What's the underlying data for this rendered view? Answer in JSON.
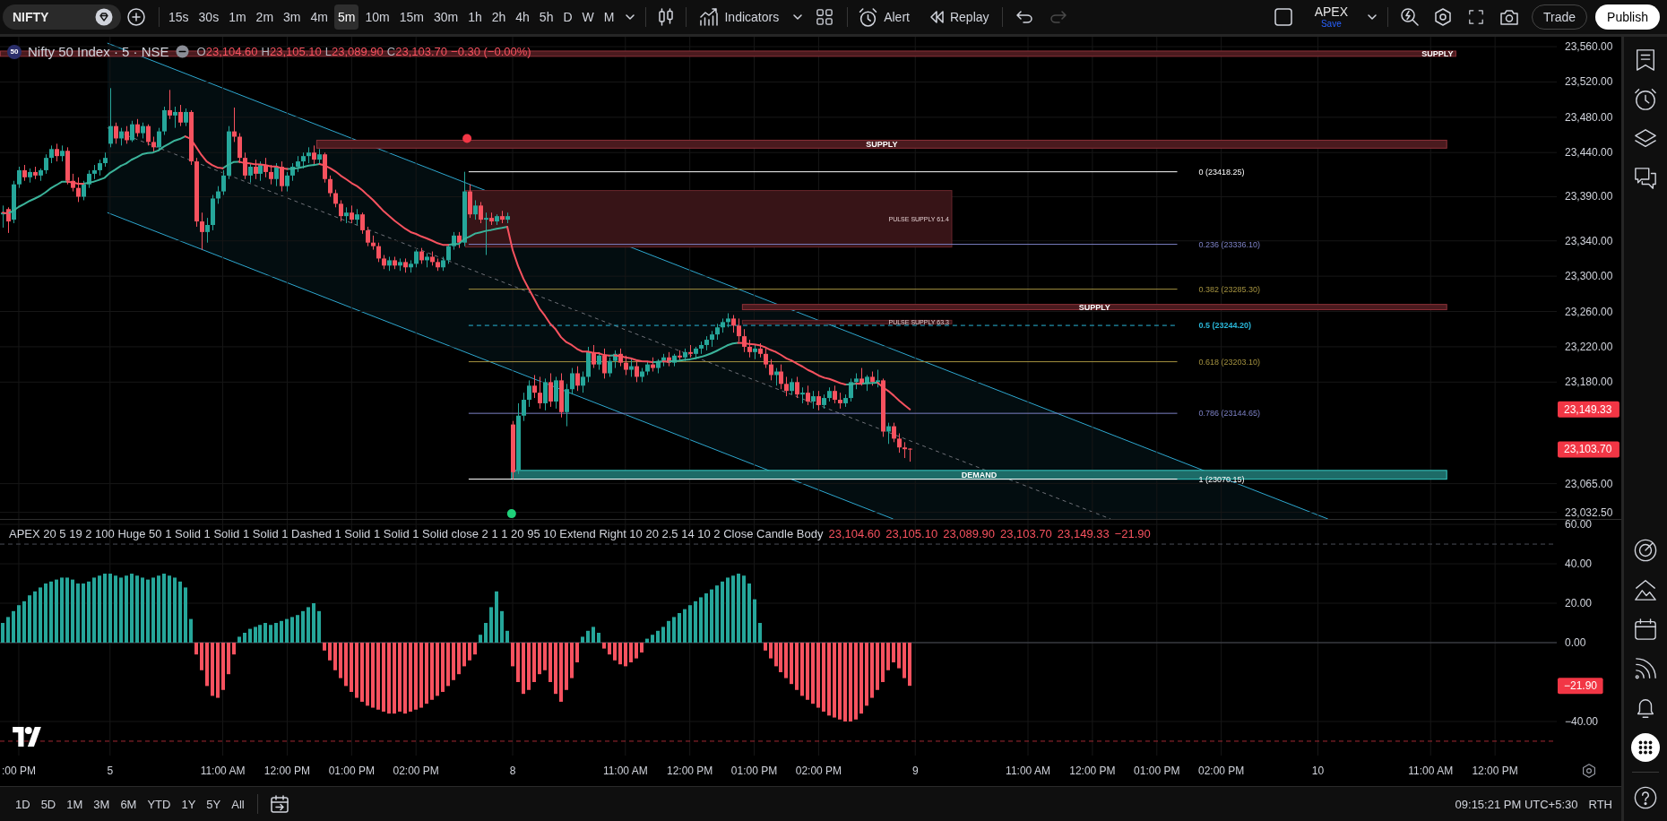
{
  "toolbar": {
    "symbol": "NIFTY",
    "timeframes": [
      {
        "label": "15s",
        "selected": false
      },
      {
        "label": "30s",
        "selected": false
      },
      {
        "label": "1m",
        "selected": false
      },
      {
        "label": "2m",
        "selected": false
      },
      {
        "label": "3m",
        "selected": false
      },
      {
        "label": "4m",
        "selected": false
      },
      {
        "label": "5m",
        "selected": true
      },
      {
        "label": "10m",
        "selected": false
      },
      {
        "label": "15m",
        "selected": false
      },
      {
        "label": "30m",
        "selected": false
      },
      {
        "label": "1h",
        "selected": false
      },
      {
        "label": "2h",
        "selected": false
      },
      {
        "label": "4h",
        "selected": false
      },
      {
        "label": "5h",
        "selected": false
      },
      {
        "label": "D",
        "selected": false
      },
      {
        "label": "W",
        "selected": false
      },
      {
        "label": "M",
        "selected": false
      }
    ],
    "indicators_label": "Indicators",
    "alert_label": "Alert",
    "replay_label": "Replay",
    "history": [
      {
        "kind": "undo",
        "disabled": false
      },
      {
        "kind": "redo",
        "disabled": true
      }
    ],
    "layout_name": "APEX",
    "save_label": "Save",
    "trade_label": "Trade",
    "publish_label": "Publish"
  },
  "price_chart": {
    "legend": {
      "logo_text": "50",
      "title": "Nifty 50 Index · 5 · NSE",
      "ohlc": [
        {
          "key": "O",
          "value": "23,104.60"
        },
        {
          "key": "H",
          "value": "23,105.10"
        },
        {
          "key": "L",
          "value": "23,089.90"
        },
        {
          "key": "C",
          "value": "23,103.70"
        }
      ],
      "change": "−0.30 (−0.00%)"
    },
    "chart_data": {
      "type": "candlestick",
      "grid": true,
      "ylim": [
        23025,
        23571.2
      ],
      "categories": [
        null,
        null,
        null,
        null,
        null,
        null,
        null,
        null,
        null,
        null,
        null,
        null,
        null,
        null,
        null,
        null,
        null,
        null,
        null,
        null,
        null,
        null,
        null,
        null,
        null,
        null,
        null,
        null,
        null,
        null,
        null,
        null,
        null,
        null,
        null,
        null,
        null,
        null,
        null,
        null,
        null,
        null,
        null,
        null,
        null,
        null,
        null,
        null,
        null,
        null,
        null,
        null,
        null,
        null,
        null,
        null,
        null,
        null,
        null,
        null,
        null,
        null,
        null,
        null,
        null,
        null,
        null,
        null,
        null,
        null,
        null,
        null,
        null,
        null,
        null,
        null,
        null,
        null,
        null,
        null,
        null,
        null,
        null,
        null,
        null,
        null,
        null,
        null,
        null,
        null,
        null,
        null,
        null,
        null,
        null,
        null,
        null,
        null,
        null,
        null,
        null,
        null,
        null,
        null,
        null,
        null,
        null,
        null,
        null,
        null,
        null,
        null,
        null,
        null,
        null,
        null,
        null,
        null,
        null,
        null,
        null,
        null,
        null,
        null,
        null,
        null,
        null,
        null,
        null,
        null,
        null,
        null,
        null,
        null,
        null,
        null,
        null,
        null,
        null,
        null,
        null,
        null,
        null,
        null,
        null,
        null,
        null,
        null,
        null,
        null,
        null,
        null,
        null,
        null,
        null,
        null,
        null,
        null,
        null,
        null,
        null,
        null,
        null,
        null,
        null,
        null,
        null,
        null,
        null,
        null,
        null,
        null,
        null,
        null,
        null,
        null,
        null,
        null,
        null,
        null,
        null,
        null,
        null,
        null,
        null,
        null,
        null,
        null,
        null,
        null,
        null,
        null,
        null,
        null,
        null,
        null,
        null,
        null,
        null,
        null,
        null,
        null,
        null,
        null,
        null,
        null,
        null,
        null,
        null,
        null,
        null,
        null,
        null,
        null,
        null,
        null,
        null,
        null,
        null,
        null,
        null,
        null,
        null,
        null,
        null,
        null,
        null,
        null,
        null,
        null,
        null,
        null,
        null,
        null,
        null,
        null,
        null,
        null,
        null,
        null,
        null,
        null,
        null,
        null,
        null,
        null,
        null,
        null,
        null,
        null,
        null,
        null,
        null,
        null,
        null,
        null,
        null,
        null,
        null,
        null,
        null,
        null,
        null,
        null,
        null,
        null,
        null,
        null,
        null,
        null,
        null,
        null,
        null,
        null,
        null,
        null,
        null,
        null,
        null,
        null,
        null,
        null,
        null,
        null,
        null,
        null,
        null,
        null,
        null,
        null
      ],
      "yticks": [
        {
          "value": 23560,
          "label": "23,560.00"
        },
        {
          "value": 23520,
          "label": "23,520.00"
        },
        {
          "value": 23480,
          "label": "23,480.00"
        },
        {
          "value": 23440,
          "label": "23,440.00"
        },
        {
          "value": 23390,
          "label": "23,390.00"
        },
        {
          "value": 23340,
          "label": "23,340.00"
        },
        {
          "value": 23300,
          "label": "23,300.00"
        },
        {
          "value": 23260,
          "label": "23,260.00"
        },
        {
          "value": 23220,
          "label": "23,220.00"
        },
        {
          "value": 23180,
          "label": "23,180.00"
        },
        {
          "value": 23065,
          "label": "23,065.00"
        },
        {
          "value": 23032.5,
          "label": "23,032.50"
        }
      ],
      "ohlc": [
        [
          23370,
          23380,
          23355,
          23372
        ],
        [
          23376,
          23378,
          23349,
          23362
        ],
        [
          23364,
          23408,
          23360,
          23404
        ],
        [
          23404,
          23424,
          23400,
          23420
        ],
        [
          23420,
          23426,
          23408,
          23412
        ],
        [
          23412,
          23422,
          23406,
          23418
        ],
        [
          23418,
          23424,
          23410,
          23414
        ],
        [
          23414,
          23422,
          23408,
          23420
        ],
        [
          23420,
          23438,
          23416,
          23434
        ],
        [
          23434,
          23448,
          23428,
          23444
        ],
        [
          23444,
          23450,
          23430,
          23436
        ],
        [
          23436,
          23448,
          23430,
          23442
        ],
        [
          23442,
          23446,
          23404,
          23408
        ],
        [
          23408,
          23416,
          23396,
          23400
        ],
        [
          23400,
          23412,
          23384,
          23390
        ],
        [
          23390,
          23408,
          23386,
          23404
        ],
        [
          23404,
          23420,
          23400,
          23416
        ],
        [
          23416,
          23426,
          23410,
          23420
        ],
        [
          23420,
          23432,
          23414,
          23428
        ],
        [
          23428,
          23440,
          23424,
          23434
        ],
        [
          23450,
          23513,
          23446,
          23470
        ],
        [
          23470,
          23474,
          23450,
          23456
        ],
        [
          23456,
          23468,
          23448,
          23464
        ],
        [
          23464,
          23470,
          23450,
          23454
        ],
        [
          23454,
          23476,
          23452,
          23472
        ],
        [
          23472,
          23478,
          23458,
          23462
        ],
        [
          23462,
          23474,
          23456,
          23470
        ],
        [
          23470,
          23472,
          23448,
          23452
        ],
        [
          23452,
          23458,
          23440,
          23446
        ],
        [
          23446,
          23468,
          23442,
          23464
        ],
        [
          23464,
          23492,
          23460,
          23488
        ],
        [
          23488,
          23511,
          23478,
          23482
        ],
        [
          23482,
          23492,
          23468,
          23486
        ],
        [
          23486,
          23494,
          23470,
          23474
        ],
        [
          23474,
          23490,
          23470,
          23486
        ],
        [
          23486,
          23488,
          23426,
          23430
        ],
        [
          23430,
          23434,
          23356,
          23362
        ],
        [
          23362,
          23372,
          23330,
          23350
        ],
        [
          23350,
          23366,
          23338,
          23358
        ],
        [
          23358,
          23392,
          23352,
          23388
        ],
        [
          23388,
          23402,
          23382,
          23396
        ],
        [
          23396,
          23420,
          23392,
          23414
        ],
        [
          23414,
          23470,
          23410,
          23464
        ],
        [
          23464,
          23491,
          23452,
          23458
        ],
        [
          23458,
          23462,
          23428,
          23434
        ],
        [
          23434,
          23440,
          23410,
          23414
        ],
        [
          23414,
          23428,
          23406,
          23424
        ],
        [
          23424,
          23432,
          23410,
          23416
        ],
        [
          23416,
          23430,
          23408,
          23426
        ],
        [
          23426,
          23434,
          23412,
          23418
        ],
        [
          23418,
          23426,
          23404,
          23410
        ],
        [
          23410,
          23428,
          23402,
          23424
        ],
        [
          23424,
          23430,
          23396,
          23402
        ],
        [
          23402,
          23418,
          23396,
          23414
        ],
        [
          23414,
          23428,
          23408,
          23424
        ],
        [
          23424,
          23436,
          23418,
          23430
        ],
        [
          23430,
          23440,
          23422,
          23436
        ],
        [
          23436,
          23446,
          23428,
          23440
        ],
        [
          23440,
          23448,
          23426,
          23432
        ],
        [
          23432,
          23444,
          23428,
          23438
        ],
        [
          23438,
          23440,
          23406,
          23410
        ],
        [
          23410,
          23414,
          23390,
          23394
        ],
        [
          23394,
          23398,
          23378,
          23382
        ],
        [
          23382,
          23386,
          23362,
          23368
        ],
        [
          23368,
          23378,
          23360,
          23372
        ],
        [
          23372,
          23380,
          23360,
          23364
        ],
        [
          23364,
          23376,
          23358,
          23370
        ],
        [
          23370,
          23372,
          23348,
          23352
        ],
        [
          23352,
          23356,
          23334,
          23338
        ],
        [
          23338,
          23346,
          23330,
          23334
        ],
        [
          23334,
          23338,
          23316,
          23320
        ],
        [
          23320,
          23324,
          23308,
          23312
        ],
        [
          23312,
          23322,
          23306,
          23318
        ],
        [
          23318,
          23322,
          23308,
          23312
        ],
        [
          23312,
          23320,
          23306,
          23316
        ],
        [
          23316,
          23320,
          23304,
          23310
        ],
        [
          23310,
          23318,
          23304,
          23314
        ],
        [
          23314,
          23330,
          23310,
          23328
        ],
        [
          23328,
          23332,
          23314,
          23318
        ],
        [
          23318,
          23326,
          23310,
          23322
        ],
        [
          23322,
          23328,
          23312,
          23316
        ],
        [
          23316,
          23320,
          23306,
          23310
        ],
        [
          23310,
          23322,
          23306,
          23318
        ],
        [
          23318,
          23336,
          23314,
          23334
        ],
        [
          23334,
          23350,
          23330,
          23346
        ],
        [
          23346,
          23350,
          23332,
          23338
        ],
        [
          23338,
          23418.25,
          23334,
          23396
        ],
        [
          23396,
          23404,
          23366,
          23370
        ],
        [
          23370,
          23386,
          23364,
          23380
        ],
        [
          23380,
          23384,
          23360,
          23364
        ],
        [
          23364,
          23372,
          23324,
          23366
        ],
        [
          23366,
          23372,
          23358,
          23362
        ],
        [
          23362,
          23370,
          23358,
          23368
        ],
        [
          23368,
          23374,
          23360,
          23364
        ],
        [
          23364,
          23372,
          23360,
          23368
        ],
        [
          23132,
          23136,
          23070,
          23078
        ],
        [
          23080,
          23156,
          23076,
          23142
        ],
        [
          23142,
          23168,
          23136,
          23160
        ],
        [
          23160,
          23182,
          23152,
          23176
        ],
        [
          23176,
          23188,
          23162,
          23168
        ],
        [
          23168,
          23186,
          23150,
          23156
        ],
        [
          23156,
          23184,
          23148,
          23180
        ],
        [
          23180,
          23190,
          23152,
          23158
        ],
        [
          23158,
          23186,
          23150,
          23182
        ],
        [
          23182,
          23190,
          23140,
          23146
        ],
        [
          23146,
          23178,
          23130,
          23172
        ],
        [
          23172,
          23196,
          23166,
          23190
        ],
        [
          23190,
          23198,
          23170,
          23176
        ],
        [
          23176,
          23192,
          23168,
          23186
        ],
        [
          23186,
          23220,
          23180,
          23214
        ],
        [
          23214,
          23222,
          23196,
          23200
        ],
        [
          23200,
          23214,
          23194,
          23210
        ],
        [
          23210,
          23218,
          23184,
          23190
        ],
        [
          23190,
          23208,
          23186,
          23204
        ],
        [
          23204,
          23216,
          23196,
          23212
        ],
        [
          23212,
          23218,
          23198,
          23202
        ],
        [
          23202,
          23210,
          23188,
          23194
        ],
        [
          23194,
          23206,
          23186,
          23198
        ],
        [
          23198,
          23204,
          23180,
          23186
        ],
        [
          23186,
          23196,
          23180,
          23192
        ],
        [
          23192,
          23204,
          23188,
          23200
        ],
        [
          23200,
          23208,
          23192,
          23196
        ],
        [
          23196,
          23206,
          23190,
          23204
        ],
        [
          23204,
          23212,
          23198,
          23208
        ],
        [
          23208,
          23214,
          23198,
          23202
        ],
        [
          23202,
          23212,
          23198,
          23210
        ],
        [
          23210,
          23216,
          23204,
          23208
        ],
        [
          23208,
          23218,
          23204,
          23214
        ],
        [
          23214,
          23222,
          23208,
          23212
        ],
        [
          23212,
          23220,
          23206,
          23218
        ],
        [
          23218,
          23226,
          23212,
          23222
        ],
        [
          23222,
          23232,
          23216,
          23228
        ],
        [
          23228,
          23238,
          23220,
          23234
        ],
        [
          23234,
          23246,
          23228,
          23242
        ],
        [
          23242,
          23252,
          23236,
          23248
        ],
        [
          23248,
          23258,
          23242,
          23252
        ],
        [
          23252,
          23256,
          23236,
          23244
        ],
        [
          23244,
          23252,
          23226,
          23232
        ],
        [
          23232,
          23240,
          23214,
          23220
        ],
        [
          23220,
          23228,
          23208,
          23214
        ],
        [
          23214,
          23222,
          23206,
          23218
        ],
        [
          23218,
          23224,
          23208,
          23212
        ],
        [
          23212,
          23218,
          23196,
          23200
        ],
        [
          23200,
          23206,
          23182,
          23188
        ],
        [
          23188,
          23196,
          23176,
          23192
        ],
        [
          23192,
          23200,
          23172,
          23178
        ],
        [
          23178,
          23186,
          23164,
          23170
        ],
        [
          23170,
          23184,
          23166,
          23180
        ],
        [
          23180,
          23186,
          23162,
          23166
        ],
        [
          23166,
          23174,
          23156,
          23168
        ],
        [
          23168,
          23176,
          23154,
          23158
        ],
        [
          23158,
          23170,
          23150,
          23164
        ],
        [
          23164,
          23170,
          23148,
          23154
        ],
        [
          23154,
          23166,
          23150,
          23162
        ],
        [
          23162,
          23174,
          23158,
          23170
        ],
        [
          23170,
          23176,
          23156,
          23160
        ],
        [
          23160,
          23168,
          23150,
          23156
        ],
        [
          23156,
          23166,
          23152,
          23162
        ],
        [
          23162,
          23184,
          23158,
          23180
        ],
        [
          23180,
          23190,
          23172,
          23184
        ],
        [
          23184,
          23196,
          23176,
          23178
        ],
        [
          23178,
          23188,
          23170,
          23186
        ],
        [
          23186,
          23192,
          23176,
          23180
        ],
        [
          23180,
          23194,
          23174,
          23182
        ],
        [
          23182,
          23184,
          23118,
          23124
        ],
        [
          23124,
          23134,
          23110,
          23130
        ],
        [
          23130,
          23134,
          23112,
          23116
        ],
        [
          23116,
          23122,
          23100,
          23106
        ],
        [
          23106,
          23112,
          23094,
          23104
        ],
        [
          23104.6,
          23105.1,
          23089.9,
          23103.7
        ],
        null,
        null,
        null,
        null,
        null,
        null,
        null,
        null,
        null,
        null,
        null,
        null,
        null,
        null,
        null,
        null,
        null,
        null,
        null,
        null,
        null,
        null,
        null,
        null,
        null,
        null,
        null,
        null,
        null,
        null,
        null,
        null,
        null,
        null,
        null,
        null,
        null,
        null,
        null,
        null,
        null,
        null,
        null,
        null,
        null,
        null,
        null,
        null,
        null,
        null,
        null,
        null,
        null,
        null,
        null,
        null,
        null,
        null,
        null,
        null,
        null,
        null,
        null,
        null,
        null,
        null,
        null,
        null,
        null,
        null,
        null,
        null,
        null,
        null,
        null,
        null,
        null,
        null,
        null,
        null,
        null,
        null,
        null,
        null,
        null,
        null,
        null,
        null,
        null,
        null,
        null,
        null,
        null,
        null,
        null,
        null,
        null,
        null,
        null,
        null,
        null,
        null,
        null,
        null,
        null,
        null,
        null,
        null,
        null,
        null,
        null,
        null,
        null,
        null,
        null,
        null,
        null,
        null,
        null,
        null
      ],
      "bands": [
        {
          "axis": "y",
          "from": 23549,
          "to": 23555,
          "label": "SUPPLY",
          "color": "#4a1a1e"
        },
        {
          "axis": "y",
          "from": 23445,
          "to": 23454,
          "label": "SUPPLY",
          "color": "#4a1a1e"
        },
        {
          "axis": "y",
          "from": 23333,
          "to": 23397,
          "label": "PULSE SUPPLY 61.4",
          "color": "#371417"
        },
        {
          "axis": "y",
          "from": 23262,
          "to": 23268,
          "label": "SUPPLY",
          "color": "#4a1a1e"
        },
        {
          "axis": "y",
          "from": 23246,
          "to": 23250,
          "label": "PULSE SUPPLY 63.3",
          "color": "#371417"
        },
        {
          "axis": "y",
          "from": 23070,
          "to": 23080,
          "label": "DEMAND",
          "color": "#1d6b67"
        }
      ],
      "ref_lines": [
        {
          "axis": "y",
          "value": 23418.25,
          "label": "0 (23418.25)",
          "color": "#ffffff"
        },
        {
          "axis": "y",
          "value": 23336.1,
          "label": "0.236 (23336.10)",
          "color": "#7c80c4"
        },
        {
          "axis": "y",
          "value": 23285.3,
          "label": "0.382 (23285.30)",
          "color": "#a3913f"
        },
        {
          "axis": "y",
          "value": 23244.2,
          "label": "0.5 (23244.20)",
          "color": "#29b6d8"
        },
        {
          "axis": "y",
          "value": 23203.1,
          "label": "0.618 (23203.10)",
          "color": "#a3913f"
        },
        {
          "axis": "y",
          "value": 23144.65,
          "label": "0.786 (23144.65)",
          "color": "#7c80c4"
        },
        {
          "axis": "y",
          "value": 23070.15,
          "label": "1 (23070.15)",
          "color": "#ffffff"
        }
      ]
    },
    "axis_badges": [
      "23,149.33",
      "23,103.70"
    ]
  },
  "indicator_pane": {
    "legend": {
      "title": "APEX 20 5 19 2 100 Huge 50 1 Solid 1 Solid 1 Solid 1 Dashed 1 Solid 1 Solid 1 Solid close 2 1 1 20 95 10 Extend Right 10 20 2.5 14 10 2 Close Candle Body",
      "values": [
        "23,104.60",
        "23,105.10",
        "23,089.90",
        "23,103.70",
        "23,149.33",
        "−21.90"
      ]
    },
    "chart_data": {
      "type": "bar",
      "grid": true,
      "ylim": [
        -57.3,
        62.3
      ],
      "yticks": [
        {
          "value": 60,
          "label": "60.00"
        },
        {
          "value": 40,
          "label": "40.00"
        },
        {
          "value": 20,
          "label": "20.00"
        },
        {
          "value": 0,
          "label": "0.00"
        },
        {
          "value": -40,
          "label": "−40.00"
        }
      ],
      "categories": [
        null,
        null,
        null,
        ":00 PM",
        null,
        null,
        null,
        null,
        null,
        null,
        null,
        null,
        null,
        null,
        null,
        null,
        null,
        null,
        null,
        null,
        "5",
        null,
        null,
        null,
        null,
        null,
        null,
        null,
        null,
        null,
        null,
        null,
        null,
        null,
        null,
        null,
        null,
        null,
        null,
        null,
        null,
        "11:00 AM",
        null,
        null,
        null,
        null,
        null,
        null,
        null,
        null,
        null,
        null,
        null,
        "12:00 PM",
        null,
        null,
        null,
        null,
        null,
        null,
        null,
        null,
        null,
        null,
        null,
        "01:00 PM",
        null,
        null,
        null,
        null,
        null,
        null,
        null,
        null,
        null,
        null,
        null,
        "02:00 PM",
        null,
        null,
        null,
        null,
        null,
        null,
        null,
        null,
        null,
        null,
        null,
        null,
        null,
        null,
        null,
        null,
        null,
        "8",
        null,
        null,
        null,
        null,
        null,
        null,
        null,
        null,
        null,
        null,
        null,
        null,
        null,
        null,
        null,
        null,
        null,
        null,
        null,
        null,
        "11:00 AM",
        null,
        null,
        null,
        null,
        null,
        null,
        null,
        null,
        null,
        null,
        null,
        "12:00 PM",
        null,
        null,
        null,
        null,
        null,
        null,
        null,
        null,
        null,
        null,
        null,
        "01:00 PM",
        null,
        null,
        null,
        null,
        null,
        null,
        null,
        null,
        null,
        null,
        null,
        "02:00 PM",
        null,
        null,
        null,
        null,
        null,
        null,
        null,
        null,
        null,
        null,
        null,
        null,
        null,
        null,
        null,
        null,
        null,
        "9",
        null,
        null,
        null,
        null,
        null,
        null,
        null,
        null,
        null,
        null,
        null,
        null,
        null,
        null,
        null,
        null,
        null,
        null,
        null,
        null,
        "11:00 AM",
        null,
        null,
        null,
        null,
        null,
        null,
        null,
        null,
        null,
        null,
        null,
        "12:00 PM",
        null,
        null,
        null,
        null,
        null,
        null,
        null,
        null,
        null,
        null,
        null,
        "01:00 PM",
        null,
        null,
        null,
        null,
        null,
        null,
        null,
        null,
        null,
        null,
        null,
        "02:00 PM",
        null,
        null,
        null,
        null,
        null,
        null,
        null,
        null,
        null,
        null,
        null,
        null,
        null,
        null,
        null,
        null,
        null,
        "10",
        null,
        null,
        null,
        null,
        null,
        null,
        null,
        null,
        null,
        null,
        null,
        null,
        null,
        null,
        null,
        null,
        null,
        null,
        null,
        null,
        "11:00 AM",
        null,
        null,
        null,
        null,
        null,
        null,
        null,
        null,
        null,
        null,
        null,
        "12:00 PM",
        null,
        null,
        null,
        null,
        null,
        null,
        null,
        null,
        null,
        null,
        null
      ],
      "values": [
        10,
        13,
        16,
        19,
        21,
        24,
        26,
        28,
        30,
        31,
        32,
        33,
        33,
        32,
        30,
        30,
        31,
        33,
        34,
        35,
        35,
        34,
        33,
        34,
        35,
        34,
        33,
        32,
        33,
        34,
        35,
        34,
        33,
        31,
        28,
        12,
        -6,
        -14,
        -22,
        -27,
        -28,
        -24,
        -16,
        -6,
        3,
        5,
        7,
        8,
        9,
        10,
        9,
        10,
        11,
        12,
        13,
        14,
        16,
        18,
        20,
        16,
        -4,
        -9,
        -14,
        -18,
        -22,
        -25,
        -28,
        -30,
        -32,
        -33,
        -34,
        -35,
        -36,
        -36,
        -35,
        -36,
        -35,
        -34,
        -33,
        -31,
        -29,
        -27,
        -25,
        -22,
        -19,
        -16,
        -12,
        -9,
        -6,
        4,
        10,
        18,
        26,
        16,
        6,
        -12,
        -20,
        -26,
        -24,
        -20,
        -16,
        -14,
        -20,
        -26,
        -30,
        -24,
        -18,
        -10,
        3,
        6,
        8,
        5,
        -3,
        -6,
        -9,
        -11,
        -12,
        -10,
        -8,
        -5,
        2,
        4,
        6,
        8,
        11,
        13,
        15,
        17,
        19,
        21,
        23,
        25,
        27,
        29,
        31,
        33,
        34,
        35,
        34,
        30,
        22,
        10,
        -4,
        -8,
        -12,
        -15,
        -18,
        -21,
        -24,
        -27,
        -29,
        -31,
        -33,
        -35,
        -37,
        -38,
        -39,
        -40,
        -40,
        -39,
        -36,
        -32,
        -28,
        -24,
        -20,
        -14,
        -10,
        -13,
        -18,
        -21.9,
        null,
        null,
        null,
        null,
        null,
        null,
        null,
        null,
        null,
        null,
        null,
        null,
        null,
        null,
        null,
        null,
        null,
        null,
        null,
        null,
        null,
        null,
        null,
        null,
        null,
        null,
        null,
        null,
        null,
        null,
        null,
        null,
        null,
        null,
        null,
        null,
        null,
        null,
        null,
        null,
        null,
        null,
        null,
        null,
        null,
        null,
        null,
        null,
        null,
        null,
        null,
        null,
        null,
        null,
        null,
        null,
        null,
        null,
        null,
        null,
        null,
        null,
        null,
        null,
        null,
        null,
        null,
        null,
        null,
        null,
        null,
        null,
        null,
        null,
        null,
        null,
        null,
        null,
        null,
        null,
        null,
        null,
        null,
        null,
        null,
        null,
        null,
        null,
        null,
        null,
        null,
        null,
        null,
        null,
        null,
        null,
        null,
        null,
        null,
        null,
        null,
        null,
        null,
        null,
        null,
        null,
        null,
        null,
        null,
        null,
        null,
        null,
        null,
        null,
        null,
        null,
        null,
        null,
        null,
        null
      ],
      "ref_lines": [
        {
          "axis": "y",
          "value": 50,
          "color": "#4a4d57"
        },
        {
          "axis": "y",
          "value": 0,
          "color": "#4a4d57"
        },
        {
          "axis": "y",
          "value": -50,
          "color": "#a32a33"
        }
      ]
    },
    "axis_badge": "−21.90"
  },
  "range_bar": {
    "ranges": [
      "1D",
      "5D",
      "1M",
      "3M",
      "6M",
      "YTD",
      "1Y",
      "5Y",
      "All"
    ],
    "clock": "09:15:21 PM UTC+5:30",
    "session": "RTH"
  }
}
